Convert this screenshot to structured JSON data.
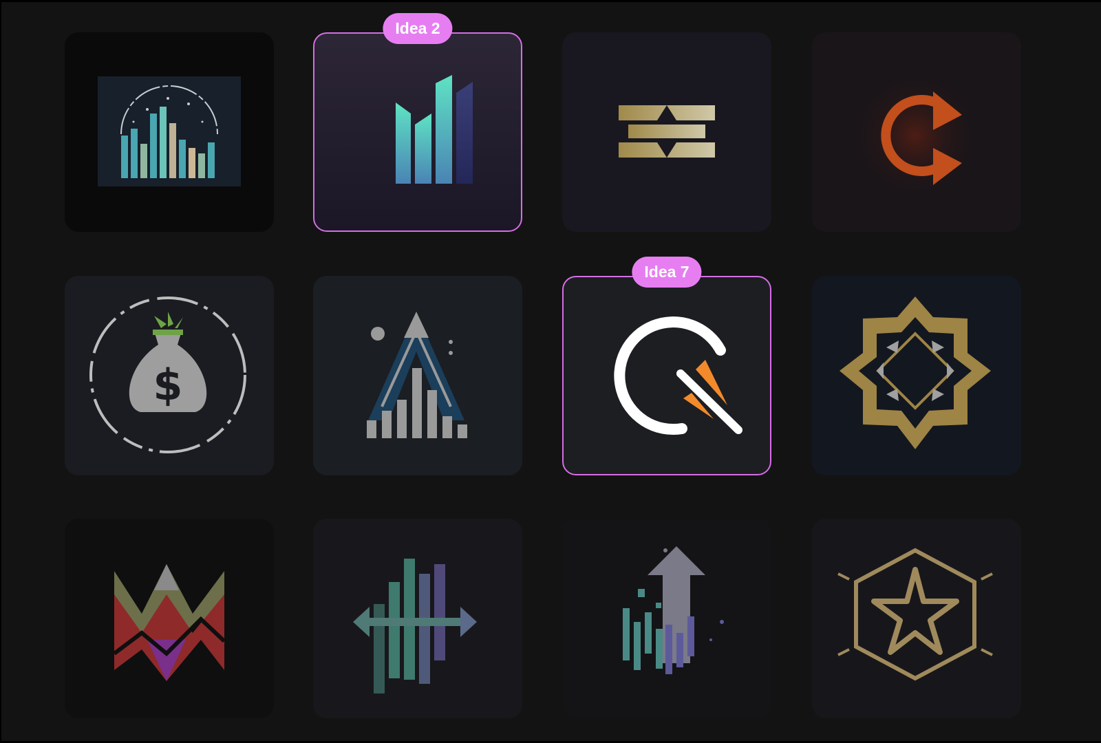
{
  "gallery": {
    "tiles": [
      {
        "icon": "city-skyline-bars-icon",
        "selected": false
      },
      {
        "icon": "teal-bar-chart-icon",
        "selected": true,
        "badge": "Idea 2"
      },
      {
        "icon": "gold-stripes-icon",
        "selected": false
      },
      {
        "icon": "orange-c-arrow-icon",
        "selected": false
      },
      {
        "icon": "money-bag-icon",
        "selected": false
      },
      {
        "icon": "arrow-bars-growth-icon",
        "selected": false
      },
      {
        "icon": "q-speed-icon",
        "selected": true,
        "badge": "Idea 7"
      },
      {
        "icon": "gold-octagon-arrows-icon",
        "selected": false
      },
      {
        "icon": "colorful-w-mountains-icon",
        "selected": false
      },
      {
        "icon": "bars-double-arrow-icon",
        "selected": false
      },
      {
        "icon": "pixel-up-arrow-icon",
        "selected": false
      },
      {
        "icon": "star-hexagon-icon",
        "selected": false
      }
    ]
  },
  "colors": {
    "background": "#131313",
    "selection_border": "#d66ee6",
    "badge_fill": "#e67ef2"
  }
}
